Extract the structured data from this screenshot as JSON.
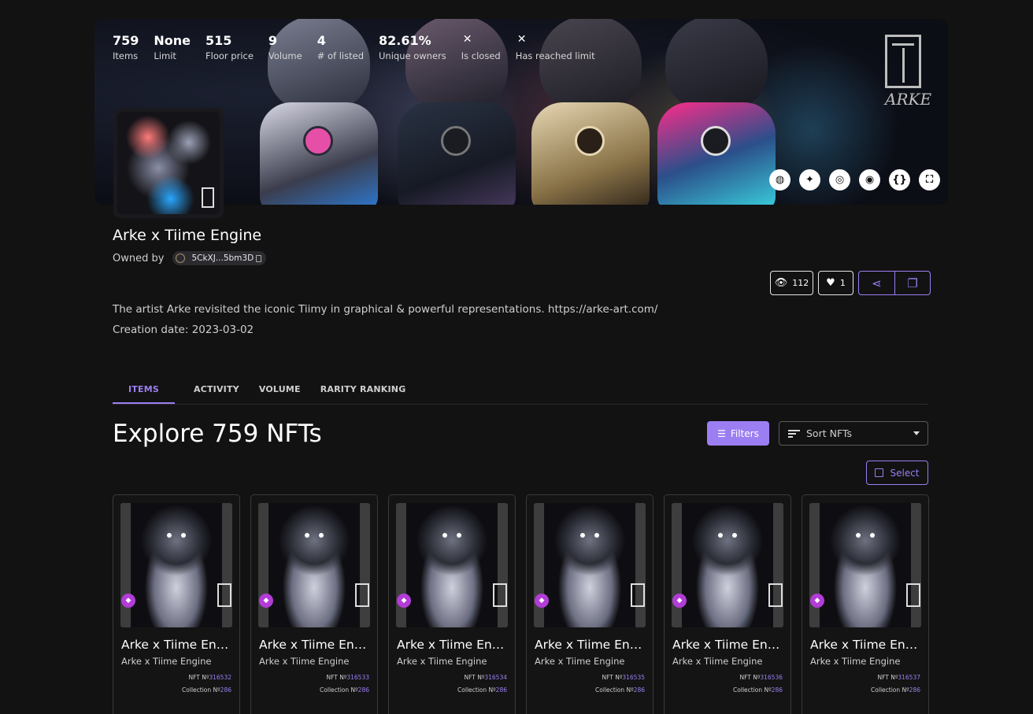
{
  "collection": {
    "title": "Arke x Tiime Engine",
    "owned_by_label": "Owned by",
    "owner_address": "5CkXJ...5bm3D",
    "description": "The artist Arke revisited the iconic Tiimy in graphical & powerful representations. https://arke-art.com/",
    "creation_date": "Creation date: 2023-03-02",
    "logo_signature": "ARKE"
  },
  "stats": [
    {
      "value": "759",
      "label": "Items"
    },
    {
      "value": "None",
      "label": "Limit"
    },
    {
      "value": "515",
      "label": "Floor price"
    },
    {
      "value": "9",
      "label": "Volume"
    },
    {
      "value": "4",
      "label": "# of listed"
    },
    {
      "value": "82.61%",
      "label": "Unique owners"
    },
    {
      "value": "✕",
      "label": "Is closed"
    },
    {
      "value": "✕",
      "label": "Has reached limit"
    }
  ],
  "socials": [
    {
      "icon": "globe-icon",
      "glyph": "◍"
    },
    {
      "icon": "twitter-icon",
      "glyph": "✦"
    },
    {
      "icon": "instagram-icon",
      "glyph": "◎"
    },
    {
      "icon": "discord-icon",
      "glyph": "◉"
    },
    {
      "icon": "json-icon",
      "glyph": "{}"
    },
    {
      "icon": "fullscreen-icon",
      "glyph": "⛶"
    }
  ],
  "actions": {
    "views": "112",
    "likes": "1"
  },
  "tabs": [
    "ITEMS",
    "ACTIVITY",
    "VOLUME",
    "RARITY RANKING"
  ],
  "explore": {
    "heading": "Explore 759 NFTs",
    "filters_label": "Filters",
    "sort_label": "Sort NFTs",
    "select_label": "Select"
  },
  "cards": [
    {
      "name": "Arke x Tiime Engi...",
      "collection": "Arke x Tiime Engine",
      "nft_label": "NFT Nº",
      "nft_number": "316532",
      "collection_label": "Collection Nº",
      "collection_number": "286"
    },
    {
      "name": "Arke x Tiime Engi...",
      "collection": "Arke x Tiime Engine",
      "nft_label": "NFT Nº",
      "nft_number": "316533",
      "collection_label": "Collection Nº",
      "collection_number": "286"
    },
    {
      "name": "Arke x Tiime Engi...",
      "collection": "Arke x Tiime Engine",
      "nft_label": "NFT Nº",
      "nft_number": "316534",
      "collection_label": "Collection Nº",
      "collection_number": "286"
    },
    {
      "name": "Arke x Tiime Engi...",
      "collection": "Arke x Tiime Engine",
      "nft_label": "NFT Nº",
      "nft_number": "316535",
      "collection_label": "Collection Nº",
      "collection_number": "286"
    },
    {
      "name": "Arke x Tiime Engi...",
      "collection": "Arke x Tiime Engine",
      "nft_label": "NFT Nº",
      "nft_number": "316536",
      "collection_label": "Collection Nº",
      "collection_number": "286"
    },
    {
      "name": "Arke x Tiime Engi...",
      "collection": "Arke x Tiime Engine",
      "nft_label": "NFT Nº",
      "nft_number": "316537",
      "collection_label": "Collection Nº",
      "collection_number": "286"
    }
  ],
  "colors": {
    "accent": "#9b7ff2",
    "background": "#121212",
    "badge": "#b23cd6"
  }
}
